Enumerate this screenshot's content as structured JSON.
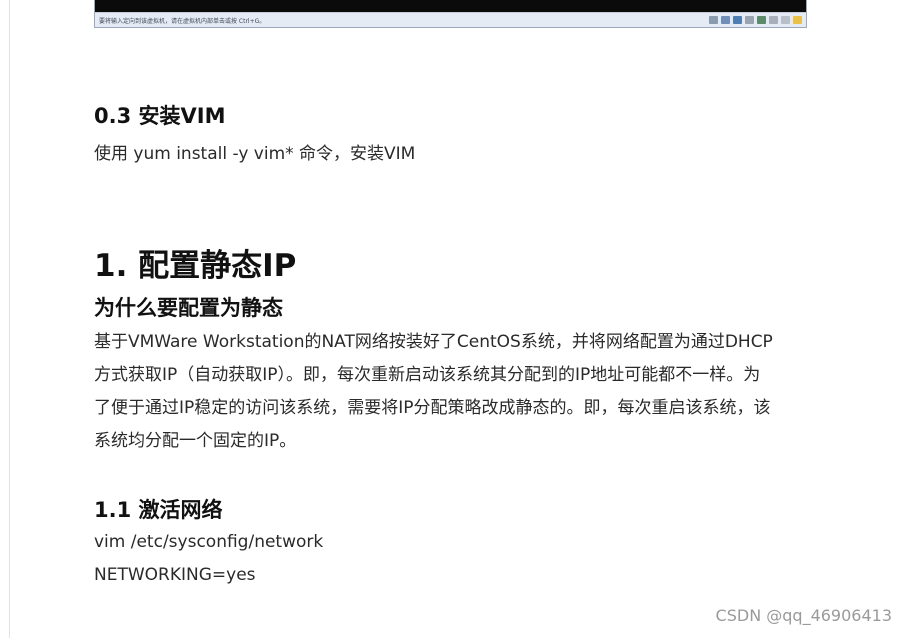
{
  "vm_status": {
    "hint": "要将输入定向到该虚拟机，请在虚拟机内部单击或按 Ctrl+G。",
    "icons": [
      "disk-icon",
      "cd-icon",
      "network-icon",
      "usb-icon",
      "sound-icon",
      "printer-icon",
      "display-icon",
      "message-icon"
    ]
  },
  "section_0_3": {
    "heading": "0.3 安装VIM",
    "text": "使用 yum install -y vim* 命令，安装VIM"
  },
  "section_1": {
    "heading": "1. 配置静态IP",
    "subheading": "为什么要配置为静态",
    "paragraph_lines": [
      "基于VMWare Workstation的NAT网络按装好了CentOS系统，并将网络配置为通过DHCP",
      "方式获取IP（自动获取IP）。即，每次重新启动该系统其分配到的IP地址可能都不一样。为",
      "了便于通过IP稳定的访问该系统，需要将IP分配策略改成静态的。即，每次重启该系统，该",
      "系统均分配一个固定的IP。"
    ]
  },
  "section_1_1": {
    "heading": "1.1 激活网络",
    "line1": "vim /etc/sysconfig/network",
    "line2": "NETWORKING=yes"
  },
  "watermark": "CSDN @qq_46906413"
}
